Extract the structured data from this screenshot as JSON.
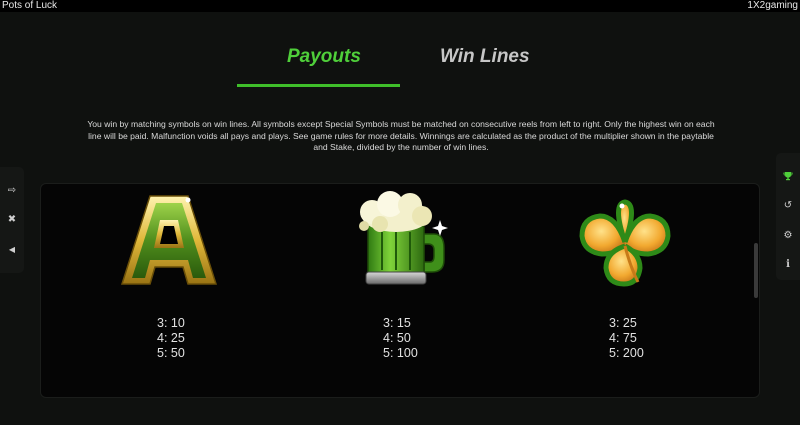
{
  "titlebar": {
    "game_title": "Pots of Luck",
    "provider": "1X2gaming"
  },
  "tabs": [
    {
      "label": "Payouts",
      "active": true
    },
    {
      "label": "Win Lines",
      "active": false
    }
  ],
  "rules_text": "You win by matching symbols on win lines. All symbols except Special Symbols must be matched on consecutive reels from left to right. Only the highest win on each line will be paid. Malfunction voids all pays and plays. See game rules for more details. Winnings are calculated as the product of the multiplier shown in the paytable and Stake, divided by the number of win lines.",
  "accent_color": "#4fcf3a",
  "left_controls": [
    {
      "icon": "exit-icon",
      "glyph": "⇨"
    },
    {
      "icon": "close-icon",
      "glyph": "✖"
    },
    {
      "icon": "sound-icon",
      "glyph": "◀"
    }
  ],
  "right_controls": [
    {
      "icon": "trophy-icon",
      "glyph": "🏆"
    },
    {
      "icon": "history-icon",
      "glyph": "↺"
    },
    {
      "icon": "settings-gear-icon",
      "glyph": "⚙"
    },
    {
      "icon": "info-icon",
      "glyph": "i"
    }
  ],
  "paytable": [
    {
      "symbol": "letter-a-symbol",
      "pays": [
        {
          "count": "3:",
          "value": "10"
        },
        {
          "count": "4:",
          "value": "25"
        },
        {
          "count": "5:",
          "value": "50"
        }
      ]
    },
    {
      "symbol": "beer-mug-symbol",
      "pays": [
        {
          "count": "3:",
          "value": "15"
        },
        {
          "count": "4:",
          "value": "50"
        },
        {
          "count": "5:",
          "value": "100"
        }
      ]
    },
    {
      "symbol": "shamrock-symbol",
      "pays": [
        {
          "count": "3:",
          "value": "25"
        },
        {
          "count": "4:",
          "value": "75"
        },
        {
          "count": "5:",
          "value": "200"
        }
      ]
    }
  ]
}
